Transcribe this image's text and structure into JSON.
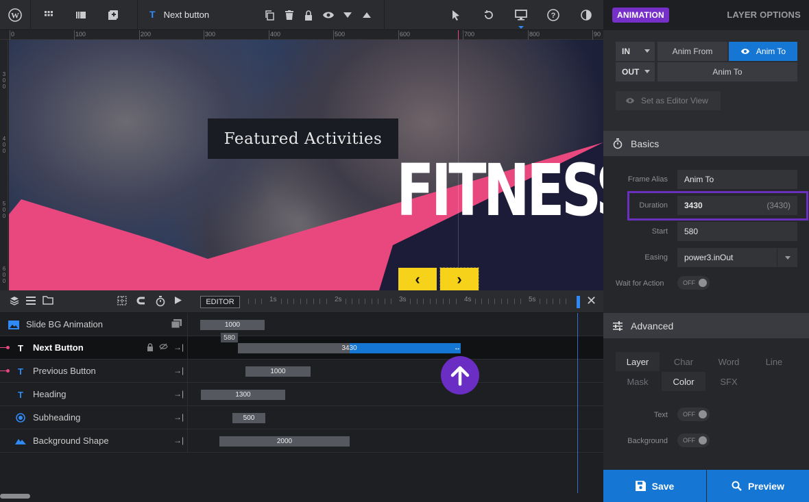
{
  "toolbar": {
    "layer_name": "Next button"
  },
  "ruler": {
    "top_marks": [
      "0",
      "100",
      "200",
      "300",
      "400",
      "500",
      "600",
      "700",
      "800",
      "90"
    ],
    "left_marks": [
      "3 0 0",
      "4 0 0",
      "5 0 0",
      "6 0 0"
    ]
  },
  "canvas": {
    "featured_text": "Featured Activities",
    "headline": "FITNESS",
    "prev_arrow": "‹",
    "next_arrow": "›"
  },
  "timeline": {
    "editor_label": "EDITOR",
    "time_marks": [
      "1s",
      "2s",
      "3s",
      "4s",
      "5s"
    ],
    "start_tag": "580",
    "rows": [
      {
        "label": "Slide BG Animation",
        "bar": "1000"
      },
      {
        "label": "Next Button",
        "bar": "3430"
      },
      {
        "label": "Previous Button",
        "bar": "1000"
      },
      {
        "label": "Heading",
        "bar": "1300"
      },
      {
        "label": "Subheading",
        "bar": "500"
      },
      {
        "label": "Background Shape",
        "bar": "2000"
      }
    ]
  },
  "panel": {
    "tab_animation": "ANIMATION",
    "tab_layer_options": "LAYER OPTIONS",
    "in_label": "IN",
    "out_label": "OUT",
    "anim_from": "Anim From",
    "anim_to": "Anim To",
    "out_anim_to": "Anim To",
    "set_editor_view": "Set as Editor View",
    "basics": {
      "title": "Basics",
      "frame_alias_label": "Frame Alias",
      "frame_alias": "Anim To",
      "duration_label": "Duration",
      "duration": "3430",
      "duration_hint": "(3430)",
      "start_label": "Start",
      "start": "580",
      "easing_label": "Easing",
      "easing": "power3.inOut",
      "wait_label": "Wait for Action",
      "wait_toggle": "OFF"
    },
    "advanced": {
      "title": "Advanced",
      "chips": [
        "Layer",
        "Char",
        "Word",
        "Line",
        "Mask",
        "Color",
        "SFX"
      ],
      "text_label": "Text",
      "text_toggle": "OFF",
      "background_label": "Background",
      "background_toggle": "OFF"
    },
    "save": "Save",
    "preview": "Preview"
  },
  "colors": {
    "accent_blue": "#1576d4",
    "accent_purple": "#7630c9",
    "pink": "#e8487e",
    "yellow": "#f7d21b"
  }
}
